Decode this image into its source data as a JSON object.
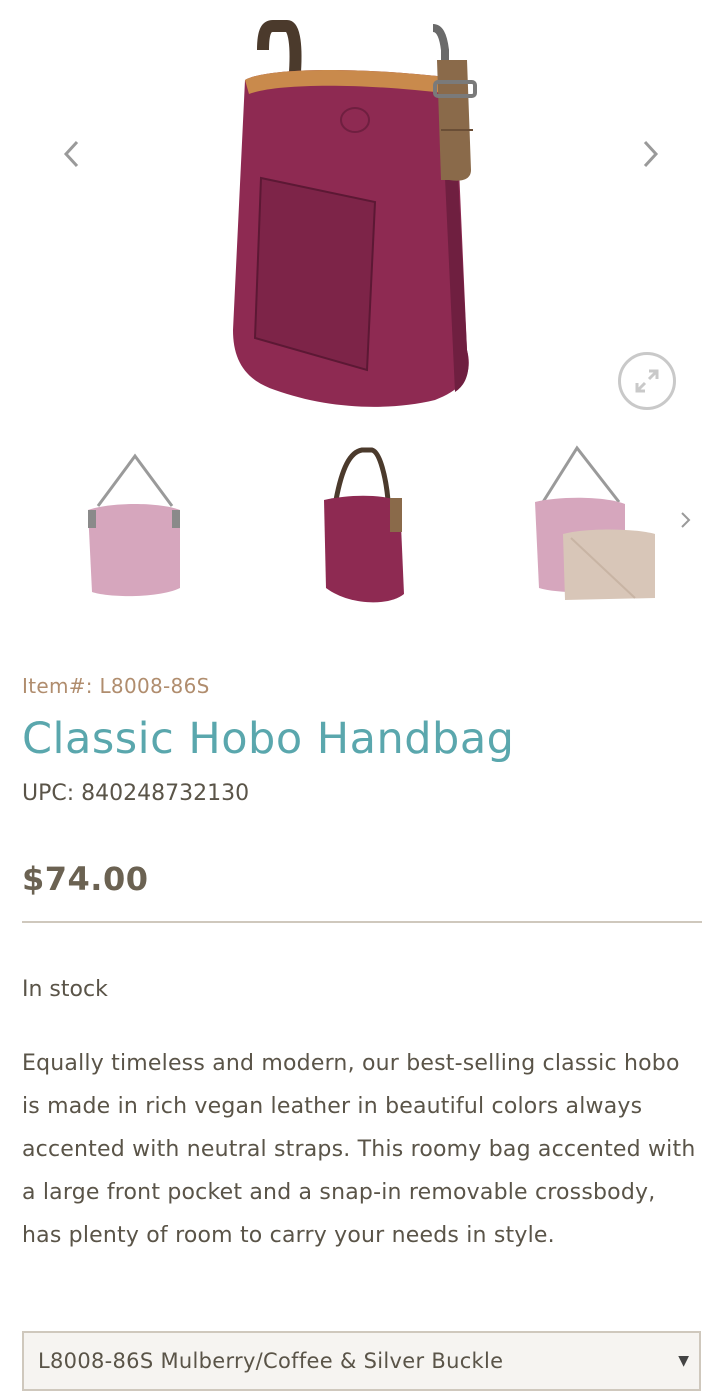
{
  "gallery": {
    "prev_icon": "chevron-left-icon",
    "next_icon": "chevron-right-icon",
    "zoom_icon": "expand-icon",
    "main_image_desc": "mulberry-hobo-bag",
    "colors": {
      "mulberry": "#8e2a52",
      "strap": "#7a5a3c",
      "lining": "#c98a4c",
      "arrow": "#9a9a9a"
    }
  },
  "thumbnails": {
    "items": [
      "pink-hobo-bag-thumb",
      "mulberry-hobo-bag-thumb",
      "pink-hobo-with-crossbody-thumb"
    ],
    "next_icon": "chevron-right-icon"
  },
  "product": {
    "item_number": "Item#: L8008-86S",
    "title": "Classic Hobo Handbag",
    "upc": "UPC: 840248732130",
    "price": "$74.00",
    "stock": "In stock",
    "description": "Equally timeless and modern, our best-selling classic hobo is made in rich vegan leather in beautiful colors always accented with neutral straps.  This roomy bag accented with a large front pocket and a snap-in removable crossbody, has plenty of room to carry your needs in style."
  },
  "variant": {
    "selected": "L8008-86S Mulberry/Coffee & Silver Buckle",
    "caret": "▼"
  },
  "colors": {
    "title": "#5aa7ad",
    "item_number": "#b08d6e",
    "price": "#6b6252",
    "text": "#5a5448",
    "divider": "#cfc8bd"
  }
}
